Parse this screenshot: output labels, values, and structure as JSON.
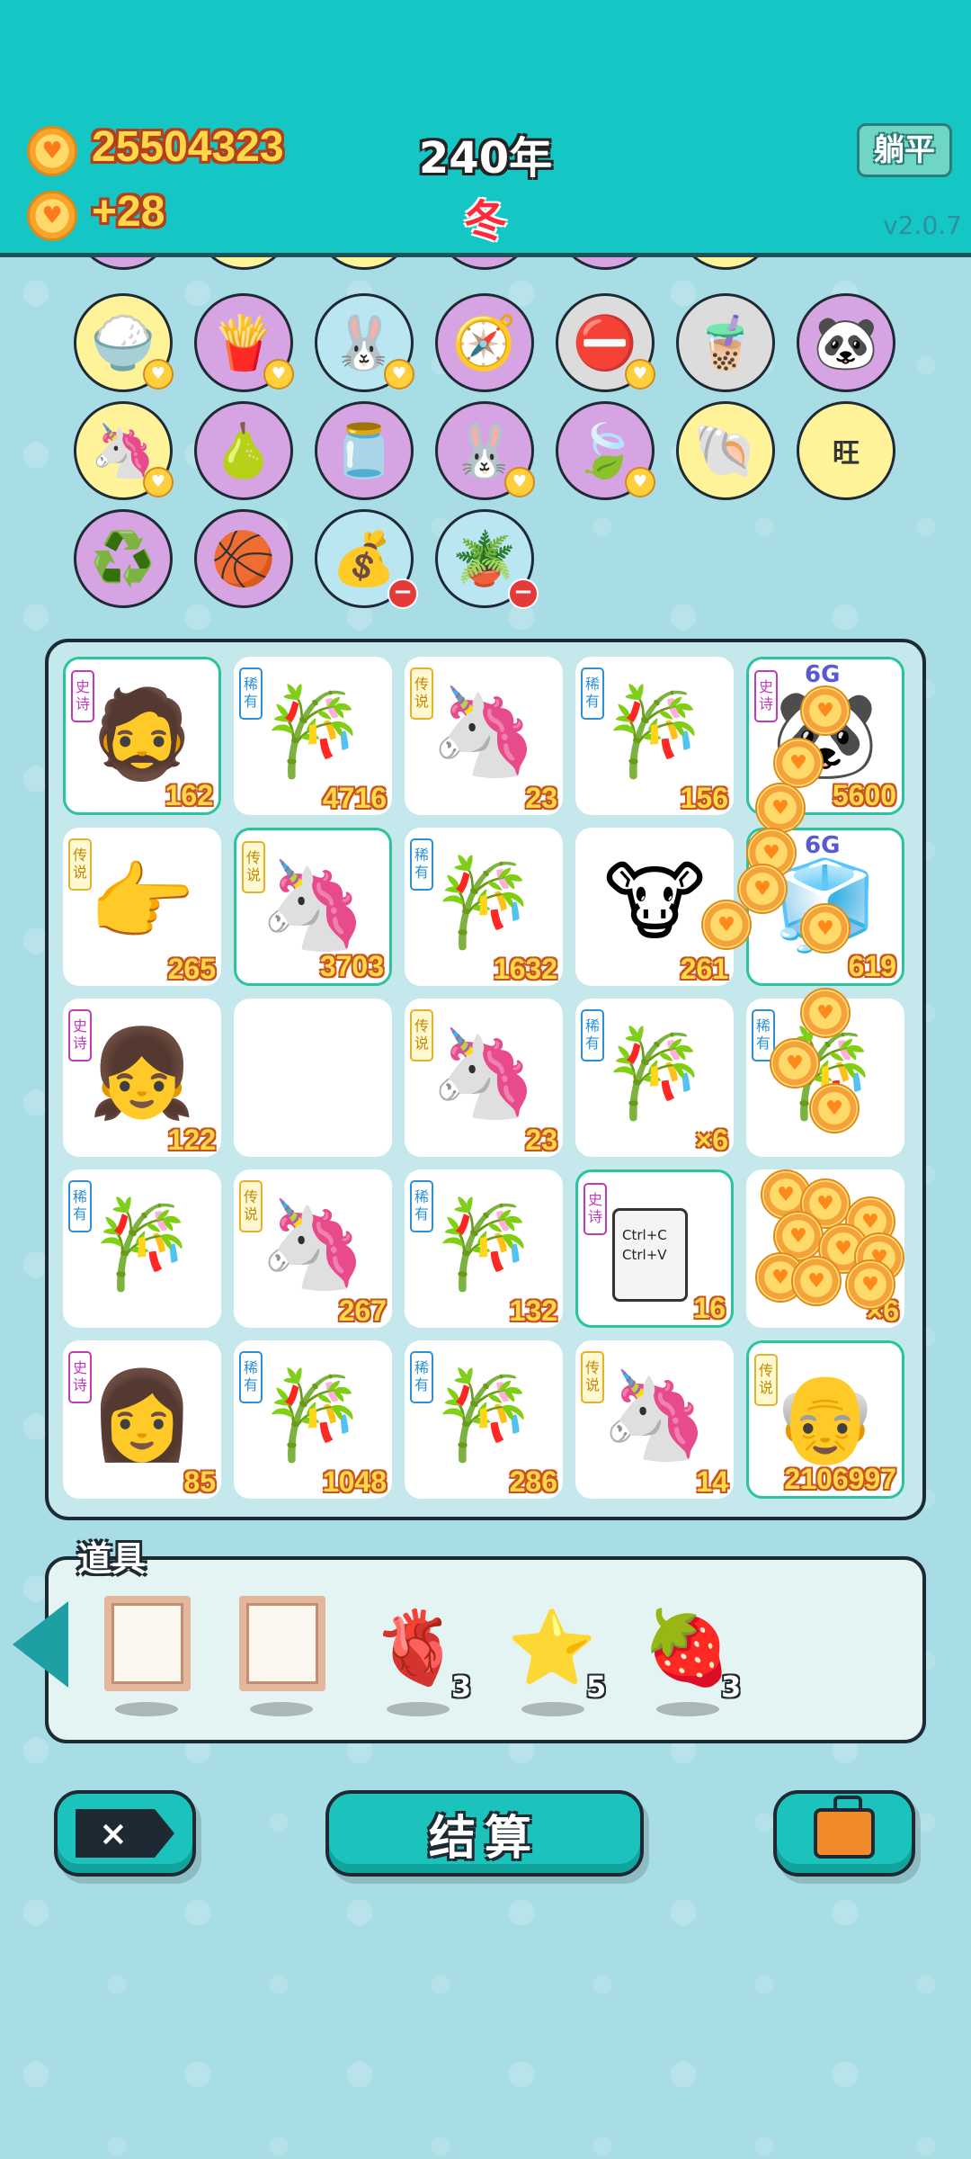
{
  "header": {
    "coins": "25504323",
    "income": "+28",
    "year": "240年",
    "season": "冬",
    "tangping_label": "躺平",
    "version": "v2.0.7"
  },
  "collection": {
    "row1": [
      "rice-bowl",
      "fries",
      "rabbit",
      "compass",
      "no-entry",
      "bubble-tea",
      "panda"
    ],
    "row2": [
      "unicorn",
      "pomelo",
      "jar",
      "rabbit",
      "leaf",
      "shell",
      "wang-wang"
    ],
    "row3": [
      "recycle",
      "basketballs",
      "money-bag",
      "flower-pot"
    ],
    "wang_text": "旺"
  },
  "board": {
    "tags": {
      "epic": "史诗",
      "rare": "稀有",
      "legend": "传说"
    },
    "tiles": [
      {
        "tag": "epic",
        "icon": "glasses-man",
        "count": "162"
      },
      {
        "tag": "rare",
        "icon": "bamboo",
        "count": "4716"
      },
      {
        "tag": "legend",
        "icon": "unicorn",
        "count": "23"
      },
      {
        "tag": "rare",
        "icon": "bamboo",
        "count": "156"
      },
      {
        "tag": "epic",
        "icon": "panda-6g",
        "count": "5600",
        "badge": "6G"
      },
      {
        "tag": "legend",
        "icon": "hand-pointer",
        "count": "265"
      },
      {
        "tag": "legend",
        "icon": "unicorn",
        "count": "3703"
      },
      {
        "tag": "rare",
        "icon": "bamboo",
        "count": "1632"
      },
      {
        "tag": "",
        "icon": "cow",
        "count": "261"
      },
      {
        "tag": "",
        "icon": "fridge-6g",
        "count": "619",
        "badge": "6G"
      },
      {
        "tag": "epic",
        "icon": "girl-braids",
        "count": "122"
      },
      {
        "tag": "",
        "icon": "",
        "count": ""
      },
      {
        "tag": "legend",
        "icon": "unicorn",
        "count": "23"
      },
      {
        "tag": "rare",
        "icon": "bamboo",
        "count": "×6"
      },
      {
        "tag": "rare",
        "icon": "bamboo",
        "count": ""
      },
      {
        "tag": "rare",
        "icon": "bamboo",
        "count": ""
      },
      {
        "tag": "legend",
        "icon": "unicorn",
        "count": "267"
      },
      {
        "tag": "rare",
        "icon": "bamboo",
        "count": "132"
      },
      {
        "tag": "epic",
        "icon": "ctrl-cv",
        "count": "16",
        "text1": "Ctrl+C",
        "text2": "Ctrl+V"
      },
      {
        "tag": "",
        "icon": "coin-pile",
        "count": "×6"
      },
      {
        "tag": "epic",
        "icon": "girl",
        "count": "85"
      },
      {
        "tag": "rare",
        "icon": "bamboo",
        "count": "1048"
      },
      {
        "tag": "rare",
        "icon": "bamboo",
        "count": "286"
      },
      {
        "tag": "legend",
        "icon": "unicorn",
        "count": "14"
      },
      {
        "tag": "legend",
        "icon": "bald-man",
        "count": "2106997"
      }
    ]
  },
  "items": {
    "title": "道具",
    "slots": [
      {
        "icon": "empty-frame",
        "count": ""
      },
      {
        "icon": "empty-frame",
        "count": ""
      },
      {
        "icon": "liver",
        "count": "3"
      },
      {
        "icon": "star",
        "count": "5"
      },
      {
        "icon": "lychee",
        "count": "3"
      }
    ]
  },
  "buttons": {
    "close": "×",
    "settle": "结算",
    "bag": "briefcase"
  },
  "colors": {
    "header": "#14c6c4",
    "board_bg": "#c4e8ec",
    "button": "#1cc3bd",
    "number_gold": "#ffd84a"
  }
}
